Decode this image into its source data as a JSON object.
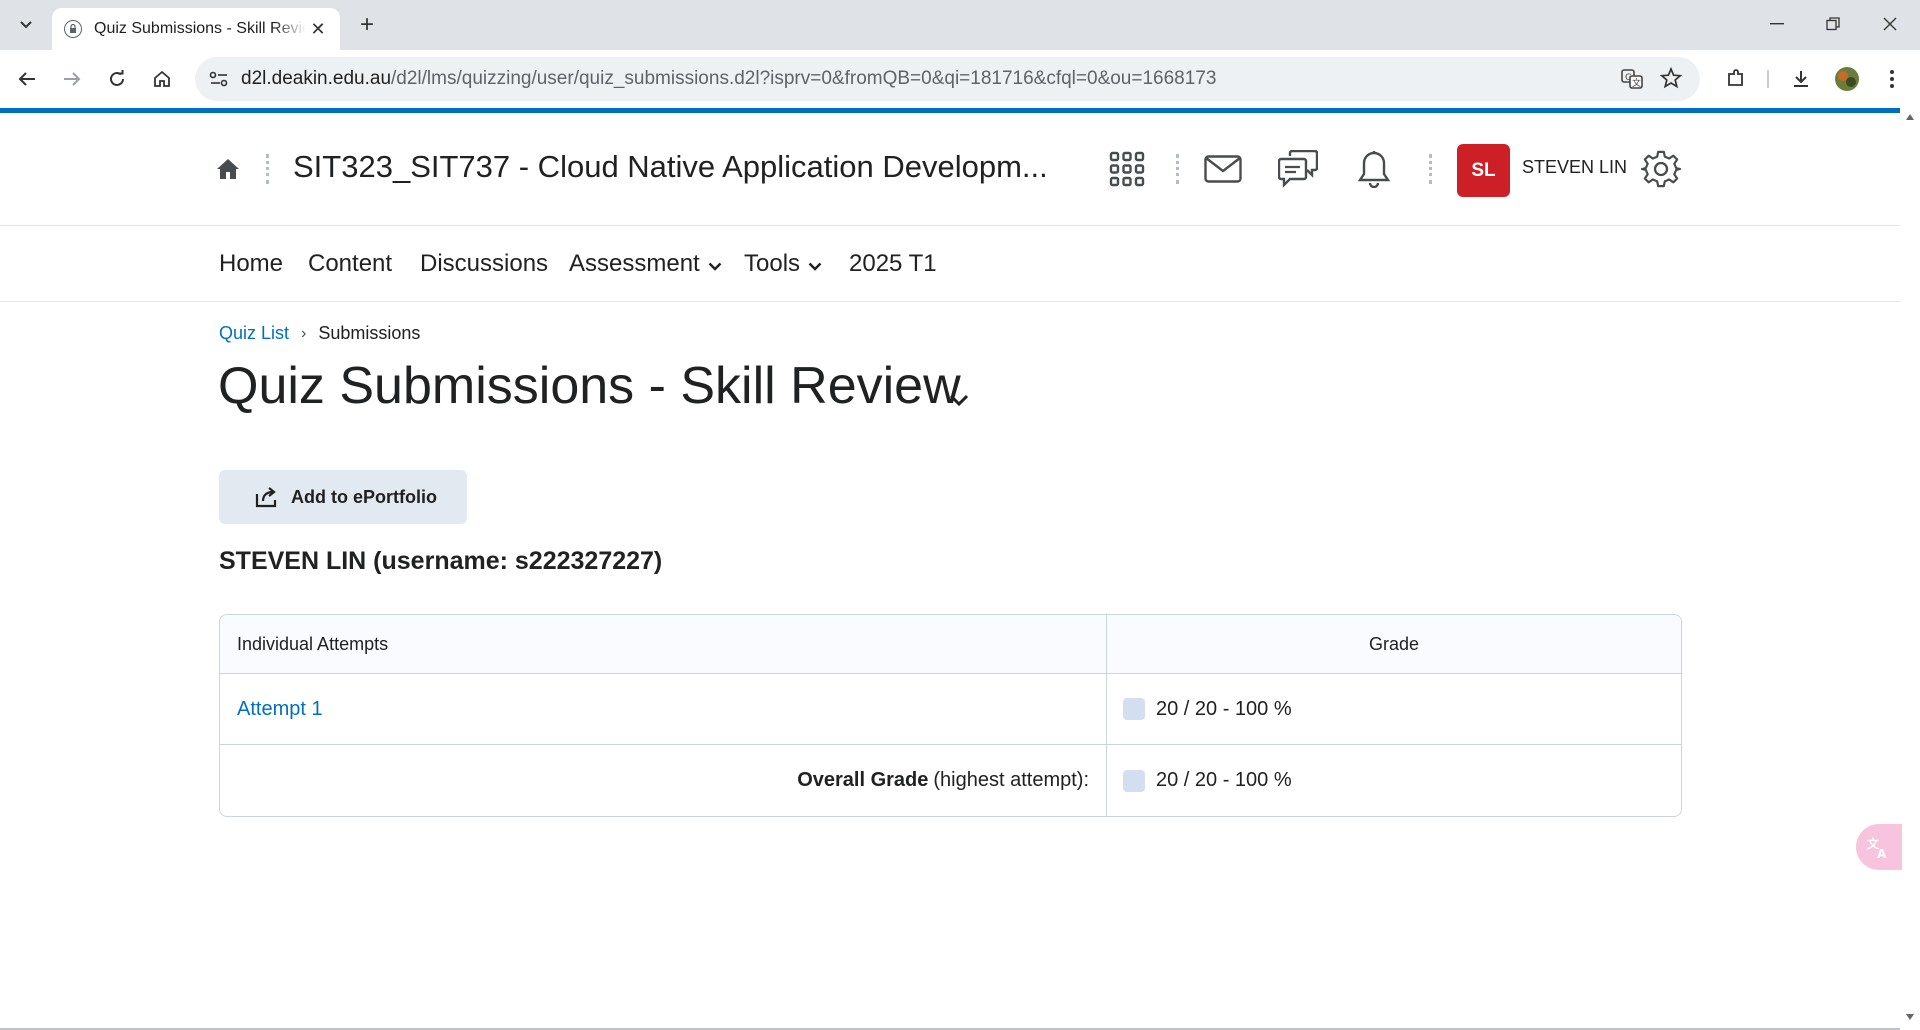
{
  "browser": {
    "tab_title": "Quiz Submissions - Skill Review",
    "url_host": "d2l.deakin.edu.au",
    "url_path": "/d2l/lms/quizzing/user/quiz_submissions.d2l?isprv=0&fromQB=0&qi=181716&cfql=0&ou=1668173"
  },
  "header": {
    "course_title": "SIT323_SIT737 - Cloud Native Application Developm...",
    "avatar_initials": "SL",
    "user_name": "STEVEN LIN",
    "avatar_color": "#cd2026"
  },
  "nav": {
    "items": [
      "Home",
      "Content",
      "Discussions",
      "Assessment",
      "Tools",
      "2025 T1"
    ]
  },
  "breadcrumb": {
    "link": "Quiz List",
    "separator": "›",
    "current": "Submissions"
  },
  "page": {
    "title": "Quiz Submissions - Skill Review",
    "eportfolio_label": "Add to ePortfolio",
    "user_heading": "STEVEN LIN (username: s222327227)"
  },
  "table": {
    "headers": [
      "Individual Attempts",
      "Grade"
    ],
    "attempts": [
      {
        "label": "Attempt 1",
        "grade": "20 / 20 - 100 %"
      }
    ],
    "overall_label": "Overall Grade",
    "overall_note": "(highest attempt):",
    "overall_grade": "20 / 20 - 100 %"
  },
  "accent_color": "#006fbf"
}
